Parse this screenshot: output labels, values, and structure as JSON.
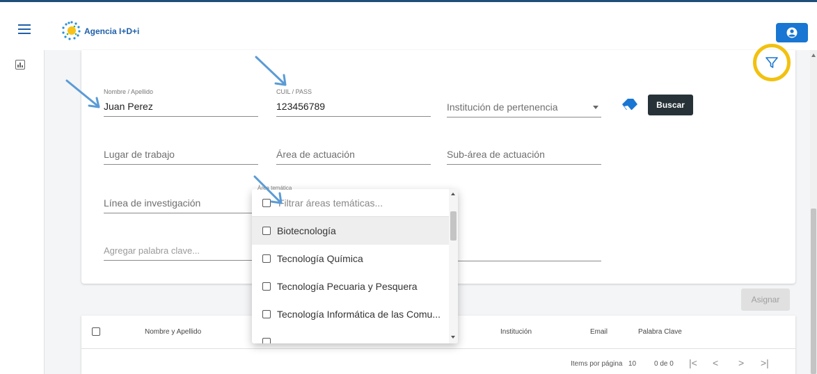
{
  "header": {
    "brand": "Agencia I+D+i",
    "colors": {
      "primary": "#1976d2",
      "dark_button": "#263238",
      "highlight_ring": "#f2c10f"
    }
  },
  "filters": {
    "nombre": {
      "label": "Nombre / Apellido",
      "value": "Juan Perez"
    },
    "cuil": {
      "label": "CUIL / PASS",
      "value": "123456789"
    },
    "institucion": {
      "placeholder": "Institución de pertenencia"
    },
    "lugar": {
      "placeholder": "Lugar de trabajo"
    },
    "area_actuacion": {
      "placeholder": "Área de actuación"
    },
    "subarea": {
      "placeholder": "Sub-área de actuación"
    },
    "linea": {
      "placeholder": "Línea de investigación"
    },
    "palabra": {
      "placeholder": "Agregar palabra clave..."
    },
    "buscar_label": "Buscar"
  },
  "area_tematica": {
    "label": "Área temática",
    "search_placeholder": "Filtrar áreas temáticas...",
    "options": [
      "Biotecnología",
      "Tecnología Química",
      "Tecnología Pecuaria y Pesquera",
      "Tecnología Informática de las Comu..."
    ]
  },
  "actions": {
    "asignar_label": "Asignar"
  },
  "table": {
    "columns": {
      "nombre": "Nombre y Apellido",
      "institucion": "Institución",
      "email": "Email",
      "palabra": "Palabra Clave"
    },
    "pagination": {
      "items_label": "Items por página",
      "page_size": "10",
      "range": "0 de 0"
    }
  }
}
